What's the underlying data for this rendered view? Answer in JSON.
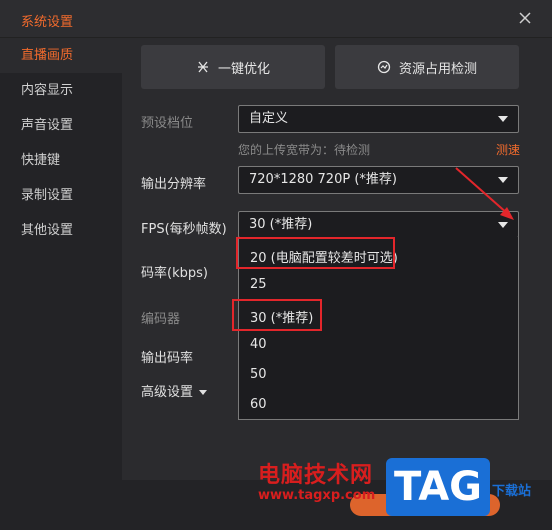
{
  "window": {
    "title": "系统设置"
  },
  "sidebar": {
    "items": [
      {
        "label": "直播画质",
        "active": true
      },
      {
        "label": "内容显示"
      },
      {
        "label": "声音设置"
      },
      {
        "label": "快捷键"
      },
      {
        "label": "录制设置"
      },
      {
        "label": "其他设置"
      }
    ]
  },
  "toolbar": {
    "optimize_label": "一键优化",
    "resource_label": "资源占用检测"
  },
  "form": {
    "preset_label": "预设档位",
    "preset_value": "自定义",
    "upload_hint": "您的上传宽带为：待检测",
    "speed_test_link": "测速",
    "resolution_label": "输出分辨率",
    "resolution_value": "720*1280 720P (*推荐)",
    "fps_label": "FPS(每秒帧数)",
    "fps_value": "30 (*推荐)",
    "bitrate_label": "码率(kbps)",
    "encoder_label": "编码器",
    "output_bitrate_label": "输出码率",
    "advanced_label": "高级设置"
  },
  "fps_options": [
    "20 (电脑配置较差时可选)",
    "25",
    "30 (*推荐)",
    "40",
    "50",
    "60"
  ],
  "watermark": {
    "site_name": "电脑技术网",
    "url": "www.tagxp.com",
    "logo": "TAG",
    "side_text": "下载站"
  },
  "colors": {
    "accent": "#f26b2d",
    "highlight_box": "#e3262b",
    "annotation_arrow": "#e3262b"
  }
}
